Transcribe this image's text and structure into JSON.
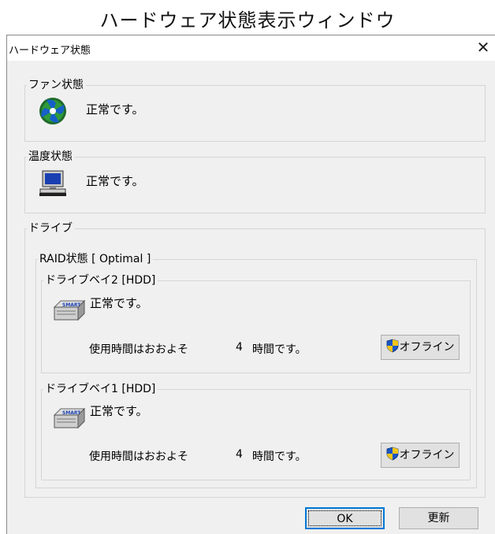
{
  "caption": "ハードウェア状態表示ウィンドウ",
  "window": {
    "title": "ハードウェア状態",
    "close_glyph": "✕"
  },
  "fan": {
    "label": "ファン状態",
    "status": "正常です。",
    "icon": "fan-icon"
  },
  "temperature": {
    "label": "温度状態",
    "status": "正常です。",
    "icon": "computer-icon"
  },
  "drive": {
    "label": "ドライブ",
    "raid_label": "RAID状態 [ Optimal ]",
    "bays": [
      {
        "label": "ドライブベイ2 [HDD]",
        "status": "正常です。",
        "usage_prefix": "使用時間はおおよそ",
        "hours": "4",
        "usage_suffix": "時間です。",
        "offline_label": "オフライン",
        "icon": "smart-drive-icon"
      },
      {
        "label": "ドライブベイ1 [HDD]",
        "status": "正常です。",
        "usage_prefix": "使用時間はおおよそ",
        "hours": "4",
        "usage_suffix": "時間です。",
        "offline_label": "オフライン",
        "icon": "smart-drive-icon"
      }
    ]
  },
  "footer": {
    "ok_label": "OK",
    "refresh_label": "更新"
  }
}
